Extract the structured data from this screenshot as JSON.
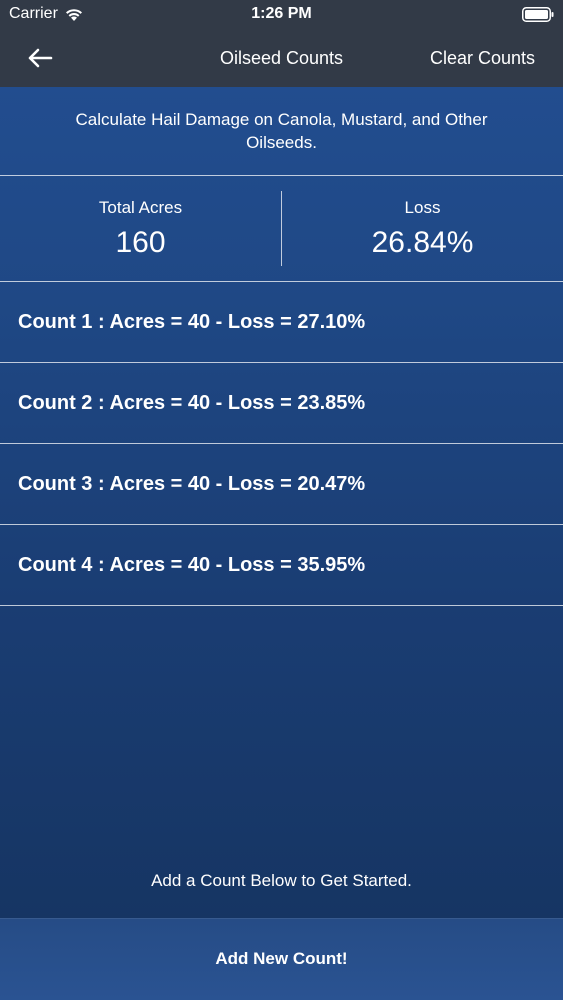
{
  "status_bar": {
    "carrier": "Carrier",
    "time": "1:26 PM"
  },
  "nav": {
    "title": "Oilseed Counts",
    "clear_label": "Clear Counts"
  },
  "intro": {
    "text": "Calculate Hail Damage on Canola, Mustard, and Other Oilseeds."
  },
  "summary": {
    "total_acres_label": "Total Acres",
    "total_acres_value": "160",
    "loss_label": "Loss",
    "loss_value": "26.84%"
  },
  "counts": [
    "Count 1 : Acres = 40 - Loss = 27.10%",
    "Count 2 : Acres = 40 - Loss = 23.85%",
    "Count 3 : Acres = 40 - Loss = 20.47%",
    "Count 4 : Acres = 40 - Loss = 35.95%"
  ],
  "hint": "Add a Count Below to Get Started.",
  "add_button_label": "Add New Count!",
  "colors": {
    "nav_background": "#323a47",
    "content_top": "#234f93",
    "content_bottom": "#15335f",
    "text": "#ffffff"
  },
  "icons": {
    "back": "arrow-left-icon",
    "wifi": "wifi-icon",
    "battery": "battery-icon"
  }
}
